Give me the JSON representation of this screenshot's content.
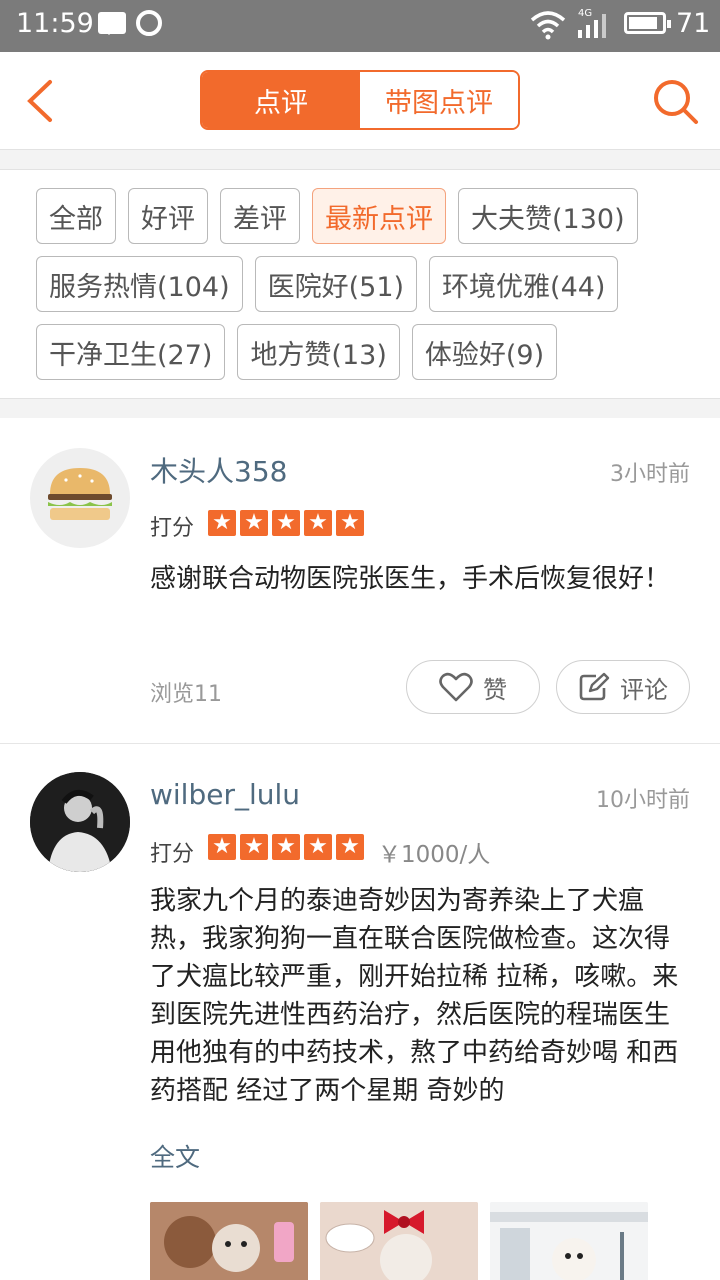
{
  "status_bar": {
    "time": "11:59",
    "network": "4G",
    "battery": "71"
  },
  "nav": {
    "tabs": [
      {
        "label": "点评",
        "active": true
      },
      {
        "label": "带图点评",
        "active": false
      }
    ]
  },
  "filters": [
    [
      {
        "label": "全部"
      },
      {
        "label": "好评"
      },
      {
        "label": "差评"
      },
      {
        "label": "最新点评",
        "active": true
      },
      {
        "label": "大夫赞(130)"
      }
    ],
    [
      {
        "label": "服务热情(104)"
      },
      {
        "label": "医院好(51)"
      },
      {
        "label": "环境优雅(44)"
      }
    ],
    [
      {
        "label": "干净卫生(27)"
      },
      {
        "label": "地方赞(13)"
      },
      {
        "label": "体验好(9)"
      }
    ]
  ],
  "reviews": [
    {
      "user": "木头人358",
      "time": "3小时前",
      "score_label": "打分",
      "rating": 5,
      "text": "感谢联合动物医院张医生，手术后恢复很好！",
      "views": "浏览11",
      "like_label": "赞",
      "comment_label": "评论"
    },
    {
      "user": "wilber_lulu",
      "time": "10小时前",
      "score_label": "打分",
      "rating": 5,
      "price": "￥1000/人",
      "text": "我家九个月的泰迪奇妙因为寄养染上了犬瘟热，我家狗狗一直在联合医院做检查。这次得了犬瘟比较严重，刚开始拉稀 拉稀，咳嗽。来到医院先进性西药治疗，然后医院的程瑞医生用他独有的中药技术，熬了中药给奇妙喝 和西药搭配 经过了两个星期 奇妙的",
      "full_text_label": "全文"
    }
  ],
  "colors": {
    "accent": "#f26a2c",
    "username": "#4f6a7f"
  }
}
